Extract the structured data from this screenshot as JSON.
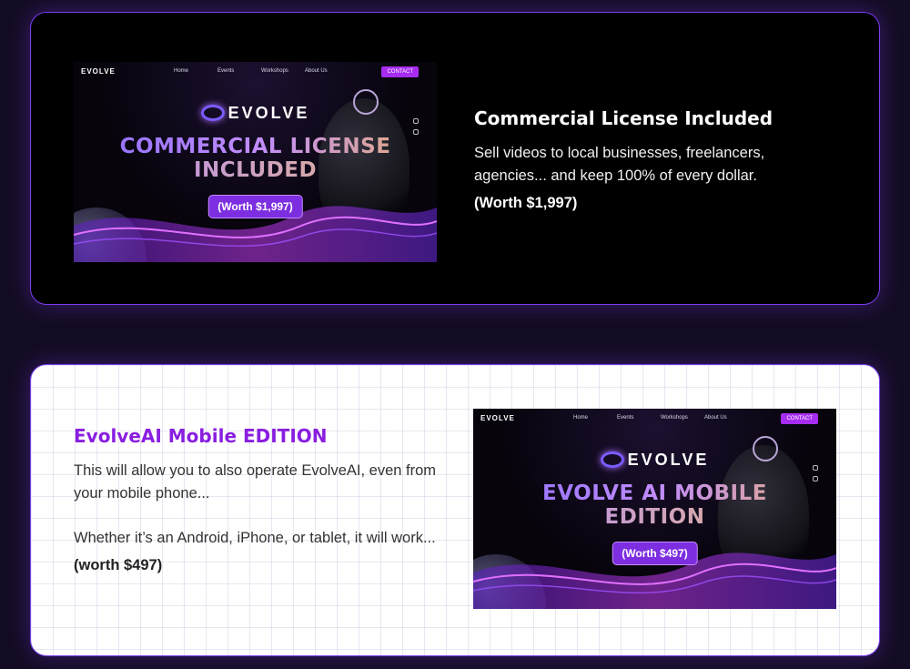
{
  "commercial": {
    "preview": {
      "logo": "EVOLVE",
      "nav": [
        "Home",
        "Events",
        "Workshops",
        "About Us"
      ],
      "contact": "CONTACT",
      "brand": "EVOLVE",
      "headline_line1": "COMMERCIAL LICENSE",
      "headline_line2": "INCLUDED",
      "worth_badge": "(Worth $1,997)"
    },
    "title": "Commercial License Included",
    "description": "Sell videos to local businesses, freelancers, agencies... and keep 100% of every dollar.",
    "worth": "(Worth $1,997)"
  },
  "mobile": {
    "preview": {
      "logo": "EVOLVE",
      "nav": [
        "Home",
        "Events",
        "Workshops",
        "About Us"
      ],
      "contact": "CONTACT",
      "brand": "EVOLVE",
      "headline_line1": "EVOLVE AI MOBILE",
      "headline_line2": "EDITION",
      "worth_badge": "(Worth $497)"
    },
    "title": "EvolveAI Mobile EDITION",
    "description1": "This will allow you to also operate EvolveAI, even from your mobile phone...",
    "description2": "Whether it’s an Android, iPhone, or tablet, it will work...",
    "worth": "(worth $497)"
  },
  "colors": {
    "page_bg": "#140c24",
    "accent": "#7b3cf0",
    "title_purple": "#8a1ee0",
    "contact_button": "#a62cf0"
  }
}
